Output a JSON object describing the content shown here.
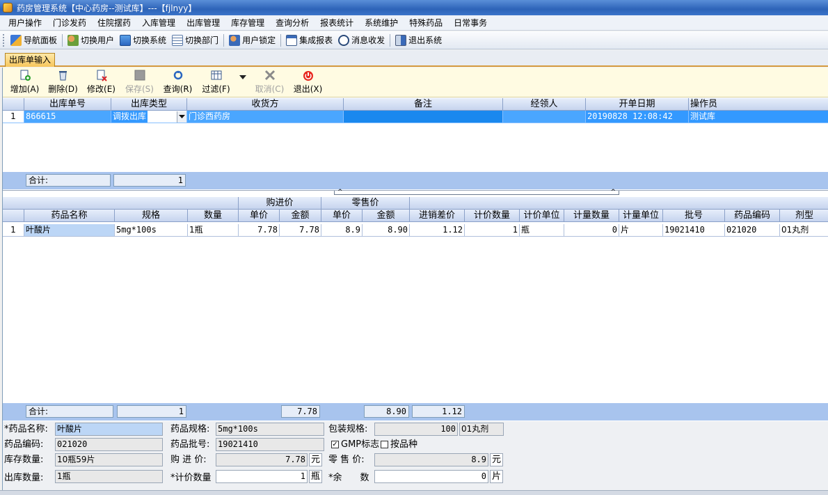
{
  "window": {
    "title": "药房管理系统【中心药房--测试库】---【fjlnyy】"
  },
  "menu": [
    "用户操作",
    "门诊发药",
    "住院摆药",
    "入库管理",
    "出库管理",
    "库存管理",
    "查询分析",
    "报表统计",
    "系统维护",
    "特殊药品",
    "日常事务"
  ],
  "toolbar": [
    {
      "label": "导航面板",
      "icon": "navigation-panel-icon"
    },
    {
      "label": "切换用户",
      "icon": "switch-user-icon"
    },
    {
      "label": "切换系统",
      "icon": "switch-system-icon"
    },
    {
      "label": "切换部门",
      "icon": "switch-department-icon"
    },
    {
      "label": "用户锁定",
      "icon": "user-lock-icon"
    },
    {
      "label": "集成报表",
      "icon": "integrated-report-icon"
    },
    {
      "label": "消息收发",
      "icon": "message-icon"
    },
    {
      "label": "退出系统",
      "icon": "exit-system-icon"
    }
  ],
  "tab": {
    "label": "出库单输入"
  },
  "actions": {
    "add": "增加(A)",
    "delete": "删除(D)",
    "modify": "修改(E)",
    "save": "保存(S)",
    "query": "查询(R)",
    "filter": "过滤(F)",
    "cancel": "取消(C)",
    "exit": "退出(X)"
  },
  "upper": {
    "columns": [
      "出库单号",
      "出库类型",
      "收货方",
      "备注",
      "经领人",
      "开单日期",
      "操作员"
    ],
    "row": {
      "index": "1",
      "order_no": "866615",
      "type": "调拨出库",
      "receiver": "门诊西药房",
      "remark": "",
      "handler": "",
      "date": "20190828 12:08:42",
      "operator": "测试库"
    },
    "total_label": "合计:",
    "total_count": "1"
  },
  "lower": {
    "group_purchase": "购进价",
    "group_retail": "零售价",
    "columns": [
      "药品名称",
      "规格",
      "数量",
      "单价",
      "金额",
      "单价",
      "金额",
      "进销差价",
      "计价数量",
      "计价单位",
      "计量数量",
      "计量单位",
      "批号",
      "药品编码",
      "剂型"
    ],
    "row": [
      "1",
      "叶酸片",
      "5mg*100s",
      "1瓶",
      "7.78",
      "7.78",
      "8.9",
      "8.90",
      "1.12",
      "1",
      "瓶",
      "0",
      "片",
      "19021410",
      "021020",
      "01丸剂"
    ],
    "total_label": "合计:",
    "total_count": "1",
    "total_purchase_amount": "7.78",
    "total_retail_amount": "8.90",
    "total_diff": "1.12"
  },
  "detail": {
    "drug_name_label": "*药品名称:",
    "drug_name": "叶酸片",
    "spec_label": "药品规格:",
    "spec": "5mg*100s",
    "pack_label": "包装规格:",
    "pack_qty": "100",
    "pack_form": "01丸剂",
    "code_label": "药品编码:",
    "code": "021020",
    "batch_label": "药品批号:",
    "batch": "19021410",
    "gmp_label": "GMP标志",
    "by_variety_label": "按品种",
    "stock_label": "库存数量:",
    "stock": "10瓶59片",
    "purchase_label": "购 进 价:",
    "purchase": "7.78",
    "purchase_unit": "元",
    "retail_label": "零 售 价:",
    "retail": "8.9",
    "retail_unit": "元",
    "out_qty_label": "出库数量:",
    "out_qty": "1瓶",
    "price_qty_label": "*计价数量",
    "price_qty": "1",
    "price_unit": "瓶",
    "remain_label": "*余　　数",
    "remain": "0",
    "remain_unit": "片"
  }
}
